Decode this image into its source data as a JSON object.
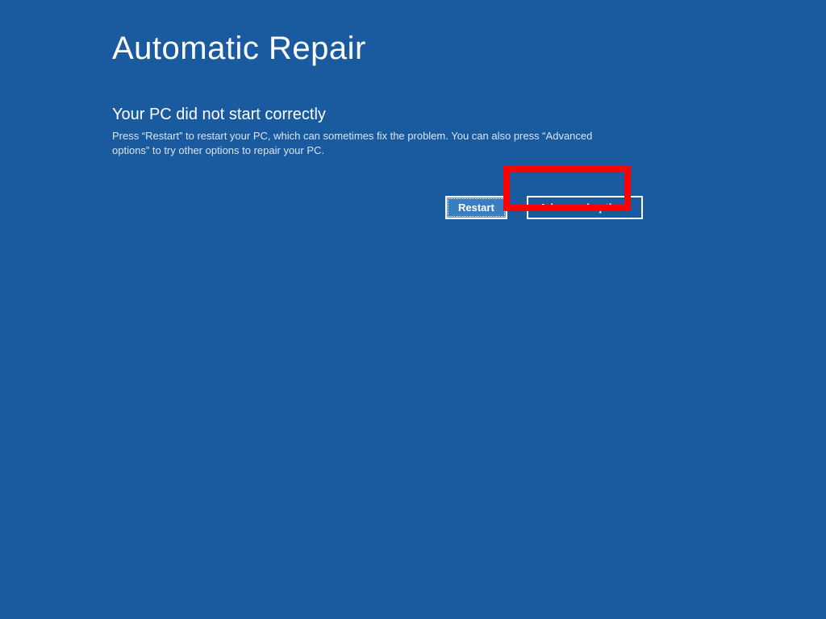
{
  "page": {
    "title": "Automatic Repair",
    "subtitle": "Your PC did not start correctly",
    "description": "Press “Restart” to restart your PC, which can sometimes fix the problem. You can also press “Advanced options” to try other options to repair your PC."
  },
  "buttons": {
    "restart_label": "Restart",
    "advanced_label": "Advanced options"
  },
  "colors": {
    "background": "#1a5a9e",
    "highlight": "#ff0000"
  }
}
